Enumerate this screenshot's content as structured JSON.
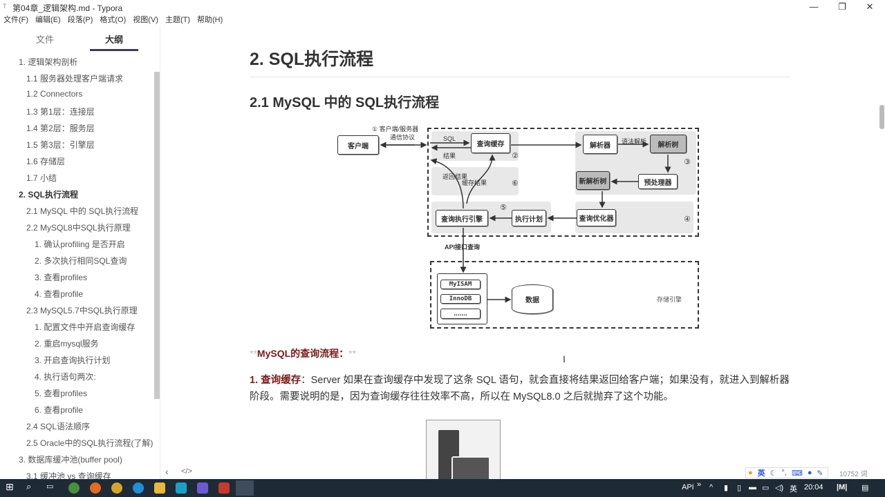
{
  "window": {
    "title": "第04章_逻辑架构.md - Typora",
    "min": "—",
    "max": "❐",
    "close": "✕"
  },
  "menu": [
    "文件(F)",
    "编辑(E)",
    "段落(P)",
    "格式(O)",
    "视图(V)",
    "主题(T)",
    "帮助(H)"
  ],
  "sidebar": {
    "tabs": [
      "文件",
      "大纲"
    ],
    "outline": [
      {
        "label": "1. 逻辑架构剖析",
        "level": 1
      },
      {
        "label": "1.1 服务器处理客户端请求",
        "level": 2
      },
      {
        "label": "1.2 Connectors",
        "level": 2
      },
      {
        "label": "1.3 第1层：连接层",
        "level": 2
      },
      {
        "label": "1.4 第2层：服务层",
        "level": 2
      },
      {
        "label": "1.5 第3层：引擎层",
        "level": 2
      },
      {
        "label": "1.6 存储层",
        "level": 2
      },
      {
        "label": "1.7 小结",
        "level": 2
      },
      {
        "label": "2. SQL执行流程",
        "level": 1,
        "active": true
      },
      {
        "label": "2.1 MySQL 中的 SQL执行流程",
        "level": 2
      },
      {
        "label": "2.2 MySQL8中SQL执行原理",
        "level": 2
      },
      {
        "label": "1. 确认profiling 是否开启",
        "level": 3
      },
      {
        "label": "2. 多次执行相同SQL查询",
        "level": 3
      },
      {
        "label": "3. 查看profiles",
        "level": 3
      },
      {
        "label": "4. 查看profile",
        "level": 3
      },
      {
        "label": "2.3 MySQL5.7中SQL执行原理",
        "level": 2
      },
      {
        "label": "1. 配置文件中开启查询缓存",
        "level": 3
      },
      {
        "label": "2. 重启mysql服务",
        "level": 3
      },
      {
        "label": "3. 开启查询执行计划",
        "level": 3
      },
      {
        "label": "4. 执行语句两次:",
        "level": 3
      },
      {
        "label": "5. 查看profiles",
        "level": 3
      },
      {
        "label": "6. 查看profile",
        "level": 3
      },
      {
        "label": "2.4 SQL语法顺序",
        "level": 2
      },
      {
        "label": "2.5 Oracle中的SQL执行流程(了解)",
        "level": 2
      },
      {
        "label": "3. 数据库缓冲池(buffer pool)",
        "level": 1
      },
      {
        "label": "3.1 缓冲池 vs 查询缓存",
        "level": 2
      }
    ]
  },
  "content": {
    "h1": "2. SQL执行流程",
    "h2": "2.1 MySQL 中的 SQL执行流程",
    "diagram": {
      "client": "客户端",
      "protocol1": "① 客户端/服务器",
      "protocol2": "通信协议",
      "sql": "SQL",
      "result": "结果",
      "cache": "查询缓存",
      "n2": "②",
      "return_result": "返回结果",
      "cache_result": "缓存结果",
      "n6": "⑥",
      "parser": "解析器",
      "syntax": "语法解析",
      "parse_tree": "解析树",
      "n3": "③",
      "preprocessor": "预处理器",
      "new_tree": "新解析树",
      "optimizer": "查询优化器",
      "n4": "④",
      "plan": "执行计划",
      "n5": "⑤",
      "engine": "查询执行引擎",
      "api": "API接口查询",
      "myisam": "MyISAM",
      "innodb": "InnoDB",
      "more": ".......",
      "data": "数据",
      "storage": "存储引擎"
    },
    "strong_marker": "**",
    "strong_text": "MySQL的查询流程：",
    "para_num": "1. 查询缓存",
    "para_text": "：Server 如果在查询缓存中发现了这条 SQL 语句，就会直接将结果返回给客户端；如果没有，就进入到解析器阶段。需要说明的是，因为查询缓存往往效率不高，所以在 MySQL8.0 之后就抛弃了这个功能。"
  },
  "statusbar": {
    "back": "‹",
    "code": "</>",
    "wordcount": "10752 词"
  },
  "ime": {
    "lang": "英"
  },
  "taskbar": {
    "api": "API",
    "more": "»",
    "lang": "英",
    "time": "20:04"
  }
}
